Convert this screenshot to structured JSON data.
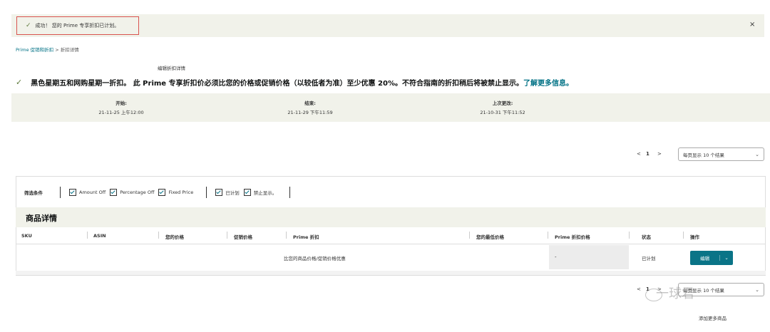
{
  "banner": {
    "message": "成功！ 您的 Prime 专享折扣已计划。",
    "close": "×"
  },
  "breadcrumb": {
    "root": "Prime 促销和折扣",
    "sep": " > ",
    "current": "折扣详情"
  },
  "section_label": "编辑折扣详情",
  "notice": {
    "text": "黑色星期五和网购星期一折扣。 此 Prime 专享折扣价必须比您的价格或促销价格（以较低者为准）至少优惠 20%。不符合指南的折扣稍后将被禁止显示。",
    "link": "了解更多信息。"
  },
  "dates": {
    "start_label": "开始:",
    "start_value": "21-11-25 上午12:00",
    "end_label": "结束:",
    "end_value": "21-11-29 下午11:59",
    "updated_label": "上次更改:",
    "updated_value": "21-10-31 下午11:52"
  },
  "pagination": {
    "prev": "<",
    "page": "1",
    "next": ">",
    "per_page": "每页显示 10 个结果"
  },
  "filters": {
    "title": "筛选条件",
    "items": [
      "Amount Off",
      "Percentage Off",
      "Fixed Price"
    ],
    "status_items": [
      "已计划",
      "禁止显示。"
    ]
  },
  "details": {
    "title": "商品详情",
    "columns": [
      "SKU",
      "ASIN",
      "您的价格",
      "促销价格",
      "Prime 折扣",
      "您的最低价格",
      "Prime 折扣价格",
      "状态",
      "操作"
    ],
    "row": {
      "note": "比您的商品价格/促销价格优惠",
      "lowest": "-",
      "status": "已计划",
      "edit": "编辑",
      "dropdown": "⌄"
    }
  },
  "watermark": "一球君",
  "add_more": "添加更多商品"
}
